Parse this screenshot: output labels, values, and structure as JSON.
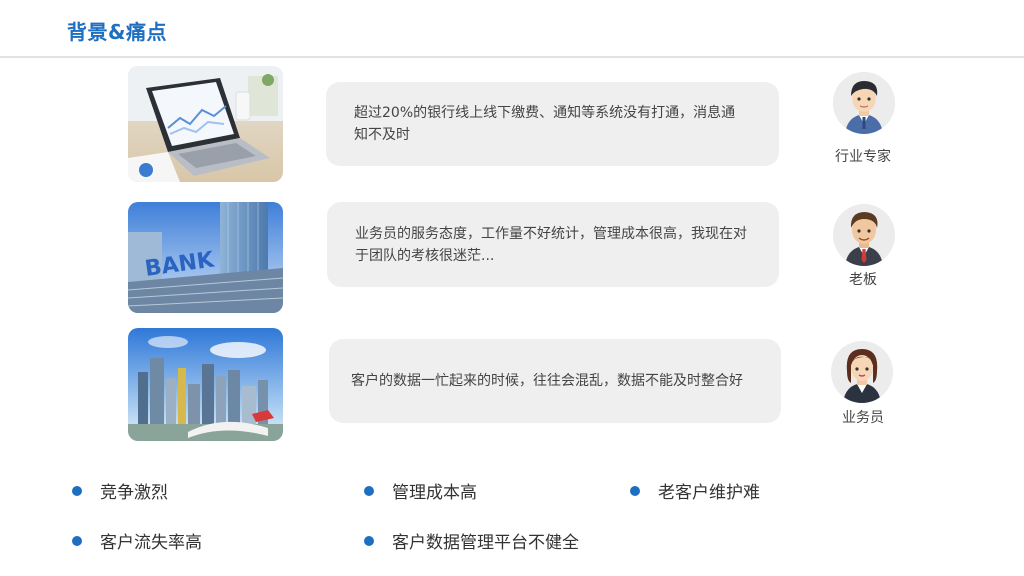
{
  "header": {
    "title": "背景&痛点"
  },
  "rows": [
    {
      "statement": "超过20%的银行线上线下缴费、通知等系统没有打通，消息通知不及时",
      "role": "行业专家"
    },
    {
      "statement": "业务员的服务态度，工作量不好统计，管理成本很高，我现在对于团队的考核很迷茫...",
      "role": "老板"
    },
    {
      "statement": "客户的数据一忙起来的时候，往往会混乱，数据不能及时整合好",
      "role": "业务员"
    }
  ],
  "keywords": [
    "竞争激烈",
    "管理成本高",
    "老客户维护难",
    "客户流失率高",
    "客户数据管理平台不健全"
  ],
  "photos": {
    "bank_sign": "BANK"
  },
  "colors": {
    "accent": "#1f6fc1",
    "bubble": "#efefef"
  }
}
